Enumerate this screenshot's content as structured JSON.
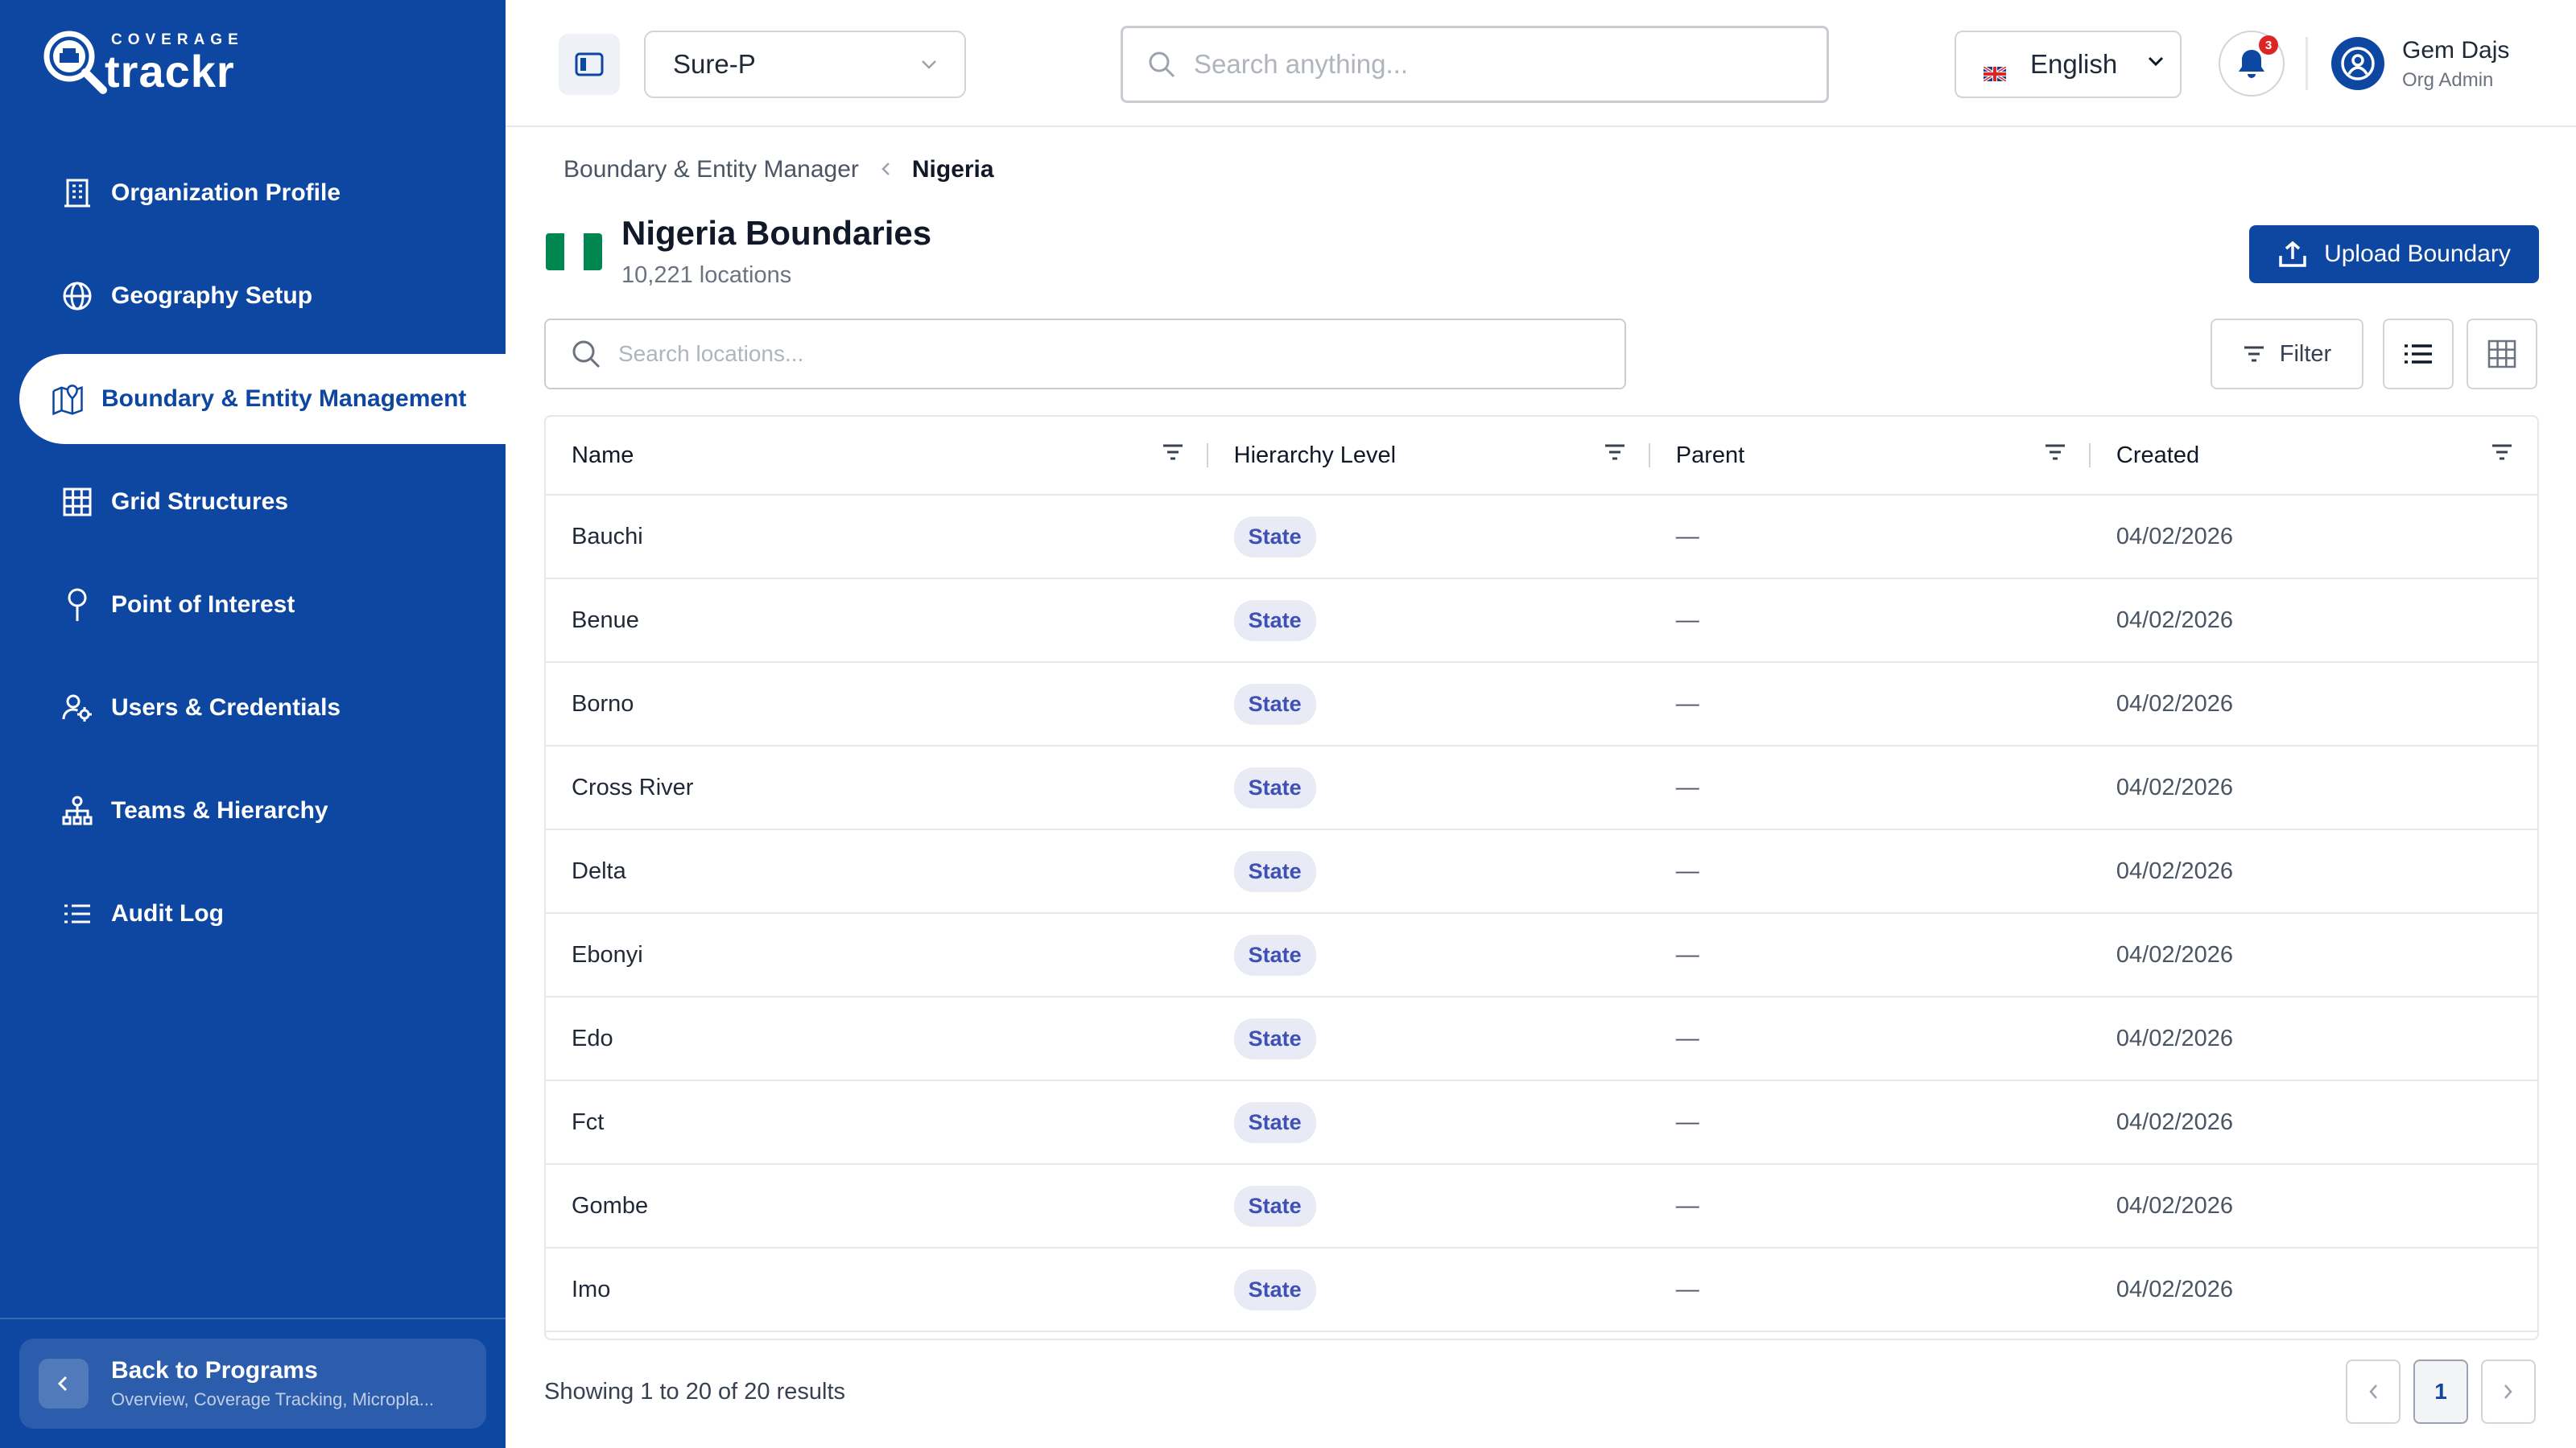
{
  "brand": {
    "small": "COVERAGE",
    "big": "trackr"
  },
  "sidebar": {
    "items": [
      {
        "label": "Organization Profile",
        "icon": "building-icon"
      },
      {
        "label": "Geography Setup",
        "icon": "globe-icon"
      },
      {
        "label": "Boundary & Entity Management",
        "icon": "map-pin-icon"
      },
      {
        "label": "Grid Structures",
        "icon": "grid-icon"
      },
      {
        "label": "Point of Interest",
        "icon": "pin-icon"
      },
      {
        "label": "Users & Credentials",
        "icon": "user-gear-icon"
      },
      {
        "label": "Teams & Hierarchy",
        "icon": "hierarchy-icon"
      },
      {
        "label": "Audit Log",
        "icon": "list-icon"
      }
    ],
    "active_index": 2,
    "back": {
      "title": "Back to Programs",
      "subtitle": "Overview, Coverage Tracking, Micropla..."
    }
  },
  "topbar": {
    "program": "Sure-P",
    "search_placeholder": "Search anything...",
    "language": "English",
    "notification_count": "3",
    "user": {
      "name": "Gem Dajs",
      "role": "Org Admin"
    }
  },
  "breadcrumb": {
    "parent": "Boundary & Entity Manager",
    "current": "Nigeria"
  },
  "page": {
    "title": "Nigeria Boundaries",
    "subtitle": "10,221 locations",
    "upload_label": "Upload Boundary",
    "search_placeholder": "Search locations...",
    "filter_label": "Filter"
  },
  "table": {
    "headers": [
      "Name",
      "Hierarchy Level",
      "Parent",
      "Created"
    ],
    "rows": [
      {
        "name": "Bauchi",
        "level": "State",
        "parent": "—",
        "created": "04/02/2026"
      },
      {
        "name": "Benue",
        "level": "State",
        "parent": "—",
        "created": "04/02/2026"
      },
      {
        "name": "Borno",
        "level": "State",
        "parent": "—",
        "created": "04/02/2026"
      },
      {
        "name": "Cross River",
        "level": "State",
        "parent": "—",
        "created": "04/02/2026"
      },
      {
        "name": "Delta",
        "level": "State",
        "parent": "—",
        "created": "04/02/2026"
      },
      {
        "name": "Ebonyi",
        "level": "State",
        "parent": "—",
        "created": "04/02/2026"
      },
      {
        "name": "Edo",
        "level": "State",
        "parent": "—",
        "created": "04/02/2026"
      },
      {
        "name": "Fct",
        "level": "State",
        "parent": "—",
        "created": "04/02/2026"
      },
      {
        "name": "Gombe",
        "level": "State",
        "parent": "—",
        "created": "04/02/2026"
      },
      {
        "name": "Imo",
        "level": "State",
        "parent": "—",
        "created": "04/02/2026"
      }
    ]
  },
  "pagination": {
    "summary": "Showing 1 to 20 of 20 results",
    "current_page": "1"
  },
  "colors": {
    "primary": "#0e47a1",
    "badge_bg": "#e8eaf6",
    "badge_text": "#3f51b5",
    "flag_green": "#008751"
  }
}
